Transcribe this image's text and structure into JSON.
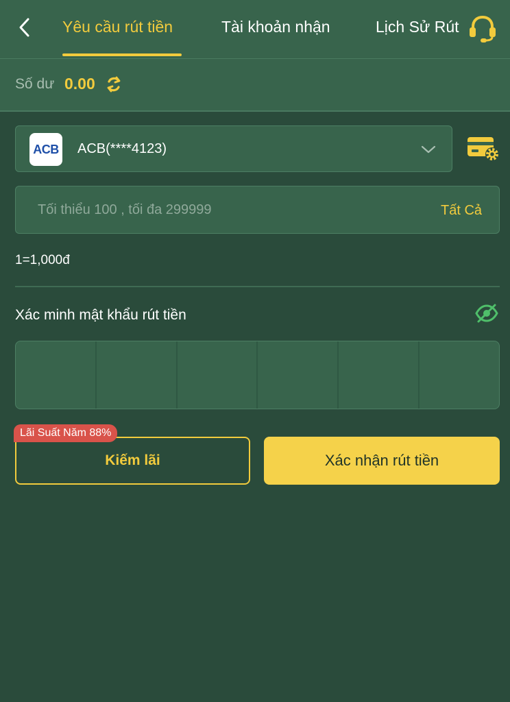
{
  "header": {
    "tabs": [
      {
        "label": "Yêu cầu rút tiền",
        "active": true
      },
      {
        "label": "Tài khoản nhận",
        "active": false
      },
      {
        "label": "Lịch Sử Rút",
        "active": false
      }
    ],
    "back_icon": "chevron-left-icon",
    "support_icon": "headset-icon"
  },
  "balance": {
    "label": "Số dư",
    "value": "0.00",
    "refresh_icon": "refresh-icon"
  },
  "bank": {
    "logo_text": "ACB",
    "account": "ACB(****4123)",
    "dropdown_icon": "chevron-down-icon",
    "settings_icon": "card-settings-icon"
  },
  "amount": {
    "placeholder": "Tối thiểu 100 , tối đa 299999",
    "value": "",
    "all_label": "Tất Cả"
  },
  "rate_text": "1=1,000đ",
  "password": {
    "label": "Xác minh mật khẩu rút tiền",
    "toggle_icon": "eye-slash-icon",
    "digits": [
      "",
      "",
      "",
      "",
      "",
      ""
    ]
  },
  "actions": {
    "earn_label": "Kiếm lãi",
    "earn_badge": "Lãi Suất Năm 88%",
    "confirm_label": "Xác nhận rút tiền"
  },
  "colors": {
    "background": "#2a4b3b",
    "panel": "#38644c",
    "accent": "#f2cb3d",
    "badge": "#d9534a"
  }
}
